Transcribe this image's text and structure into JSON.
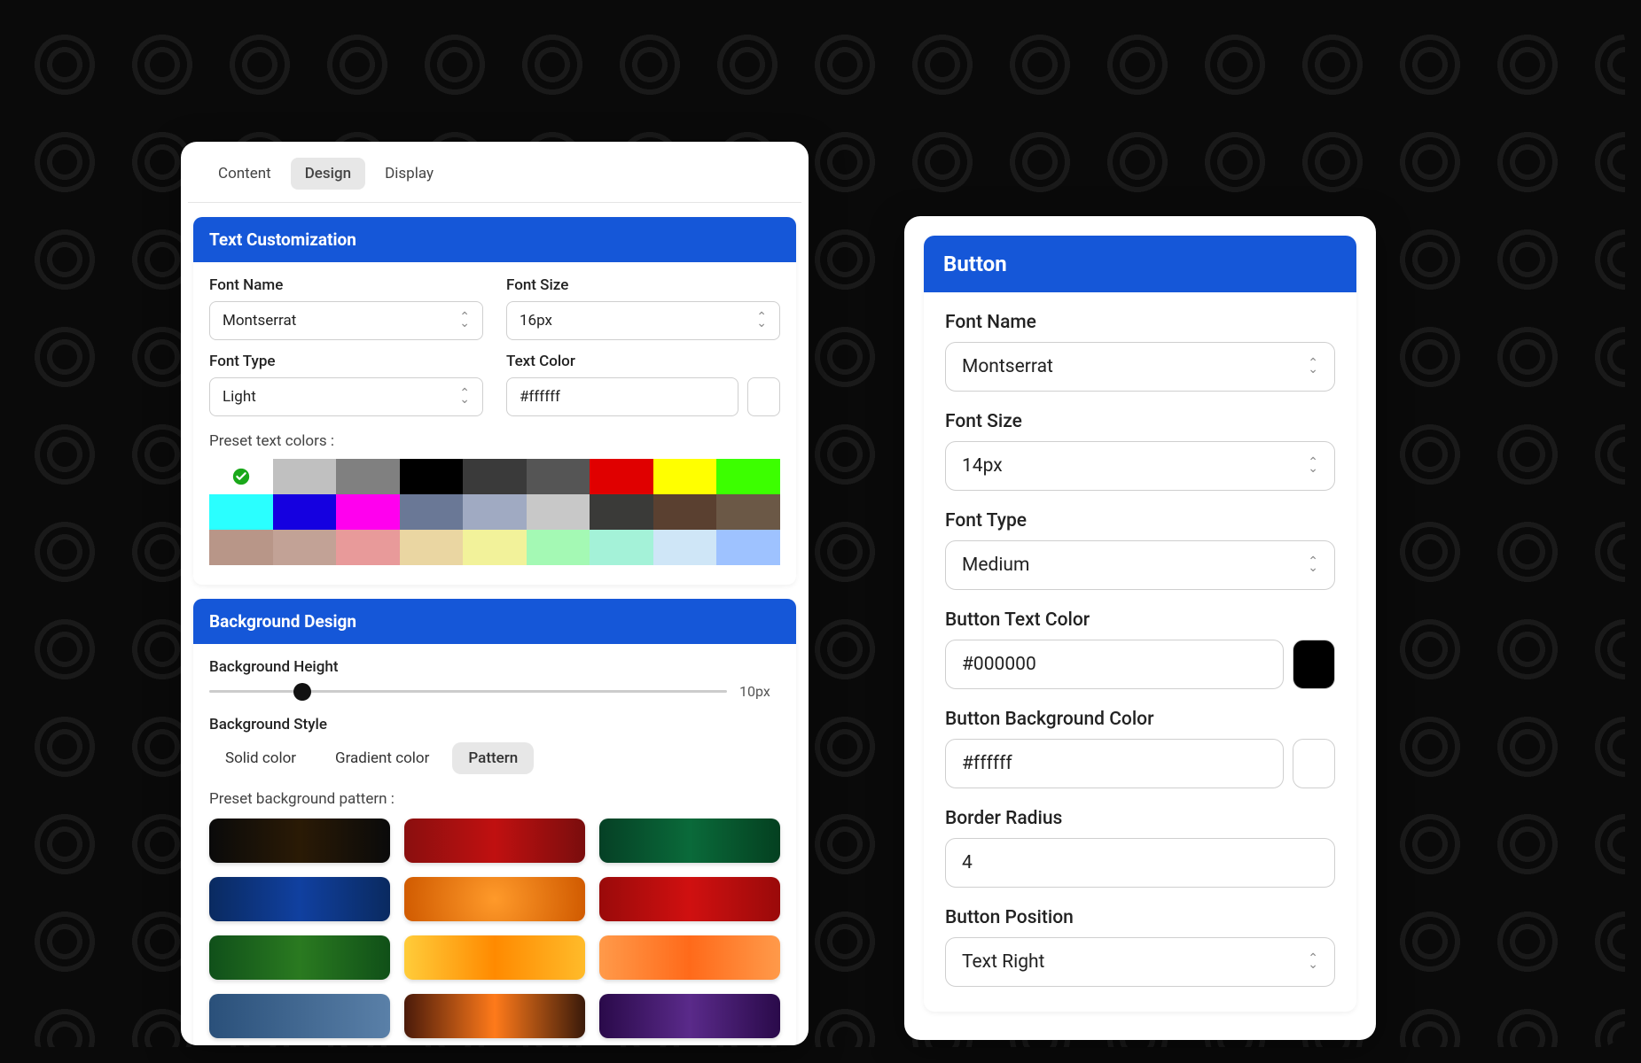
{
  "tabs": {
    "content": "Content",
    "design": "Design",
    "display": "Display",
    "active": "design"
  },
  "textCustomization": {
    "title": "Text Customization",
    "fontNameLabel": "Font Name",
    "fontName": "Montserrat",
    "fontSizeLabel": "Font Size",
    "fontSize": "16px",
    "fontTypeLabel": "Font Type",
    "fontType": "Light",
    "textColorLabel": "Text Color",
    "textColor": "#ffffff",
    "presetLabel": "Preset text colors :",
    "presetColors": [
      [
        "#ffffff",
        "#c0c0c0",
        "#808080",
        "#000000",
        "#3a3a3a",
        "#555555",
        "#e00000",
        "#ffff00",
        "#3cff00"
      ],
      [
        "#2affff",
        "#1500e0",
        "#ff00ee",
        "#6a7896",
        "#a0aac2",
        "#c8c8c8",
        "#3a3a38",
        "#5a4030",
        "#6b5846"
      ],
      [
        "#b89688",
        "#c2a296",
        "#e89a9a",
        "#ead6a2",
        "#f2f29a",
        "#a4f9b4",
        "#a4f2d8",
        "#cfe6f7",
        "#9ec2ff"
      ]
    ],
    "selectedPresetIndex": 0
  },
  "backgroundDesign": {
    "title": "Background Design",
    "heightLabel": "Background Height",
    "heightValue": "10px",
    "heightPercent": 18,
    "styleLabel": "Background Style",
    "styles": {
      "solid": "Solid color",
      "gradient": "Gradient color",
      "pattern": "Pattern",
      "active": "pattern"
    },
    "presetPatternLabel": "Preset background pattern :",
    "patterns": [
      "linear-gradient(90deg,#0a0a0a,#2a1a05 50%,#0a0a0a)",
      "linear-gradient(90deg,#8a0f0f,#c01010 50%,#7a0d0d)",
      "linear-gradient(90deg,#054025,#0a6a3a 50%,#044020)",
      "linear-gradient(90deg,#0a2a60,#1040a0 50%,#0a2a60)",
      "radial-gradient(circle,#ff9a2a,#d05a00)",
      "linear-gradient(90deg,#9a0a0a,#d01010 50%,#9a0a0a)",
      "linear-gradient(90deg,#10501a,#2a7a20 50%,#105018)",
      "linear-gradient(90deg,#ffcc3a,#ff8a00 50%,#ffbb2a)",
      "linear-gradient(90deg,#ff9a4a,#ff6a1a 50%,#ff9a4a)",
      "linear-gradient(90deg,#2a507a,#5a80a8)",
      "linear-gradient(90deg,#4a1a0a,#ff7a1a 50%,#3a1a0a)",
      "linear-gradient(90deg,#2a0a4a,#5a2a8a 50%,#2a0a4a)"
    ]
  },
  "button": {
    "title": "Button",
    "fontNameLabel": "Font Name",
    "fontName": "Montserrat",
    "fontSizeLabel": "Font Size",
    "fontSize": "14px",
    "fontTypeLabel": "Font Type",
    "fontType": "Medium",
    "textColorLabel": "Button Text Color",
    "textColor": "#000000",
    "bgColorLabel": "Button Background Color",
    "bgColor": "#ffffff",
    "radiusLabel": "Border Radius",
    "radius": "4",
    "positionLabel": "Button Position",
    "position": "Text Right"
  }
}
